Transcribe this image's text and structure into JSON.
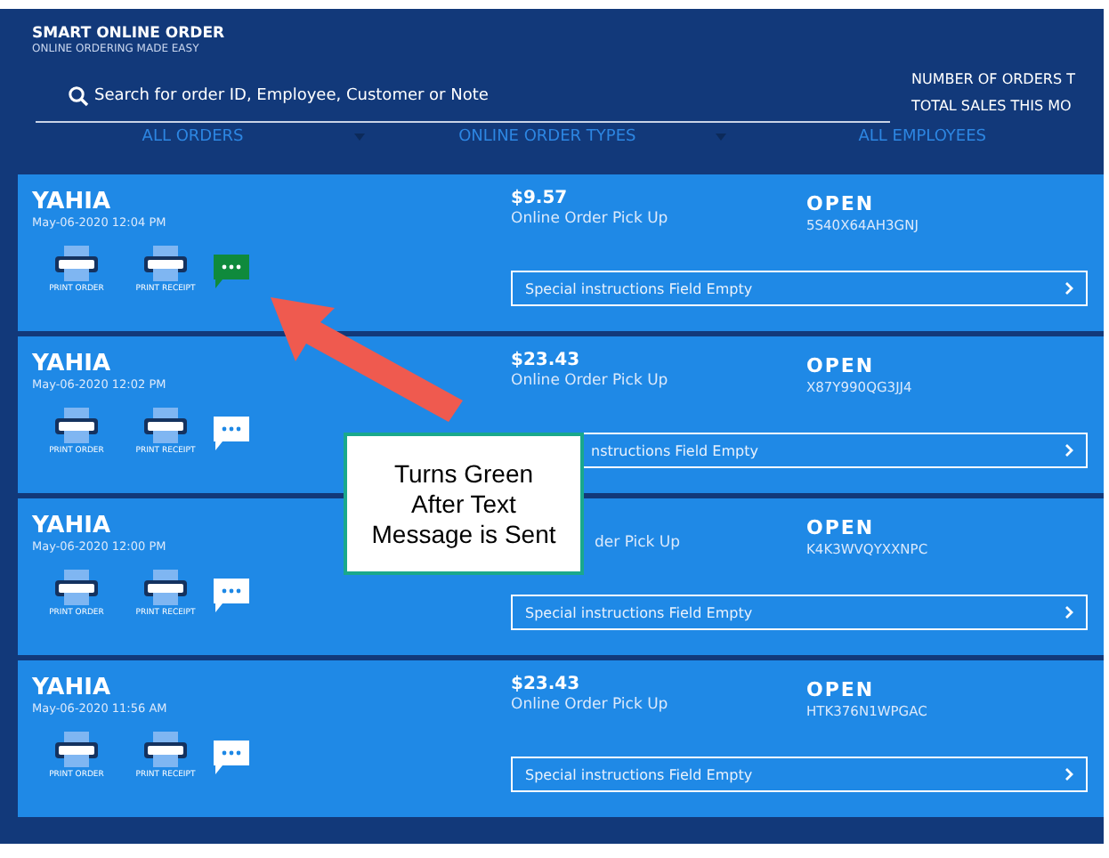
{
  "header": {
    "title": "SMART ONLINE ORDER",
    "subtitle": "ONLINE ORDERING MADE EASY",
    "search": {
      "placeholder": "Search for order ID, Employee, Customer or Note"
    },
    "stats": [
      "NUMBER OF ORDERS T",
      "TOTAL SALES THIS MO"
    ]
  },
  "filters": [
    {
      "label": "ALL ORDERS",
      "dropdown": true
    },
    {
      "label": "ONLINE ORDER TYPES",
      "dropdown": true
    },
    {
      "label": "ALL EMPLOYEES",
      "dropdown": false
    }
  ],
  "orders": [
    {
      "customer": "YAHIA",
      "date": "May-06-2020 12:04 PM",
      "print_order": "PRINT ORDER",
      "print_receipt": "PRINT RECEIPT",
      "message_sent": true,
      "total": "$9.57",
      "type": "Online Order Pick Up",
      "status": "OPEN",
      "order_id": "5S40X64AH3GNJ",
      "instructions": "Special instructions Field Empty"
    },
    {
      "customer": "YAHIA",
      "date": "May-06-2020 12:02 PM",
      "print_order": "PRINT ORDER",
      "print_receipt": "PRINT RECEIPT",
      "message_sent": false,
      "total": "$23.43",
      "type": "Online Order Pick Up",
      "status": "OPEN",
      "order_id": "X87Y990QG3JJ4",
      "instructions": "nstructions Field Empty",
      "instructions_covered": true
    },
    {
      "customer": "YAHIA",
      "date": "May-06-2020 12:00 PM",
      "print_order": "PRINT ORDER",
      "print_receipt": "PRINT RECEIPT",
      "message_sent": false,
      "type": "der Pick Up",
      "type_covered": true,
      "status": "OPEN",
      "order_id": "K4K3WVQYXXNPC",
      "instructions": "Special instructions Field Empty"
    },
    {
      "customer": "YAHIA",
      "date": "May-06-2020 11:56 AM",
      "print_order": "PRINT ORDER",
      "print_receipt": "PRINT RECEIPT",
      "message_sent": false,
      "total": "$23.43",
      "type": "Online Order Pick Up",
      "status": "OPEN",
      "order_id": "HTK376N1WPGAC",
      "instructions": "Special instructions Field Empty"
    }
  ],
  "callout": {
    "lines": [
      "Turns Green",
      "After Text",
      "Message is Sent"
    ]
  }
}
